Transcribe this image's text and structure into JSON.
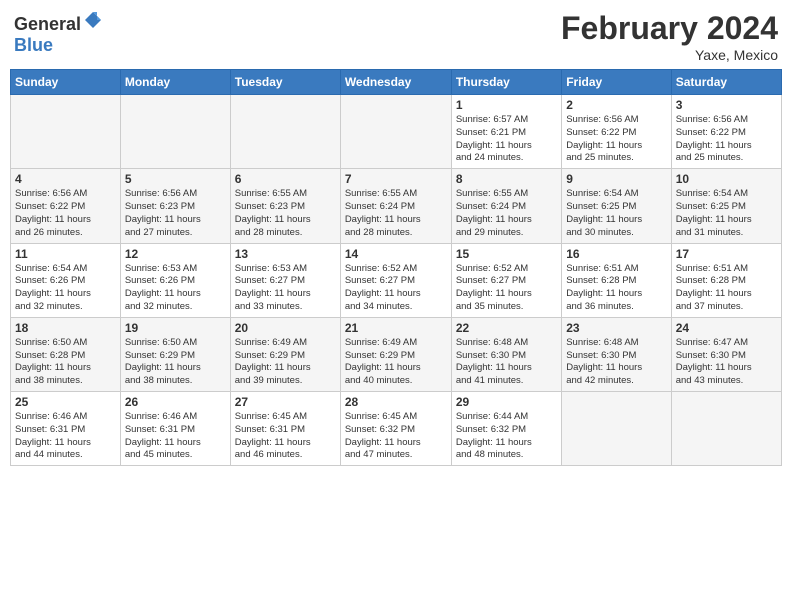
{
  "header": {
    "logo_general": "General",
    "logo_blue": "Blue",
    "month_year": "February 2024",
    "location": "Yaxe, Mexico"
  },
  "weekdays": [
    "Sunday",
    "Monday",
    "Tuesday",
    "Wednesday",
    "Thursday",
    "Friday",
    "Saturday"
  ],
  "weeks": [
    [
      {
        "day": "",
        "info": ""
      },
      {
        "day": "",
        "info": ""
      },
      {
        "day": "",
        "info": ""
      },
      {
        "day": "",
        "info": ""
      },
      {
        "day": "1",
        "info": "Sunrise: 6:57 AM\nSunset: 6:21 PM\nDaylight: 11 hours\nand 24 minutes."
      },
      {
        "day": "2",
        "info": "Sunrise: 6:56 AM\nSunset: 6:22 PM\nDaylight: 11 hours\nand 25 minutes."
      },
      {
        "day": "3",
        "info": "Sunrise: 6:56 AM\nSunset: 6:22 PM\nDaylight: 11 hours\nand 25 minutes."
      }
    ],
    [
      {
        "day": "4",
        "info": "Sunrise: 6:56 AM\nSunset: 6:22 PM\nDaylight: 11 hours\nand 26 minutes."
      },
      {
        "day": "5",
        "info": "Sunrise: 6:56 AM\nSunset: 6:23 PM\nDaylight: 11 hours\nand 27 minutes."
      },
      {
        "day": "6",
        "info": "Sunrise: 6:55 AM\nSunset: 6:23 PM\nDaylight: 11 hours\nand 28 minutes."
      },
      {
        "day": "7",
        "info": "Sunrise: 6:55 AM\nSunset: 6:24 PM\nDaylight: 11 hours\nand 28 minutes."
      },
      {
        "day": "8",
        "info": "Sunrise: 6:55 AM\nSunset: 6:24 PM\nDaylight: 11 hours\nand 29 minutes."
      },
      {
        "day": "9",
        "info": "Sunrise: 6:54 AM\nSunset: 6:25 PM\nDaylight: 11 hours\nand 30 minutes."
      },
      {
        "day": "10",
        "info": "Sunrise: 6:54 AM\nSunset: 6:25 PM\nDaylight: 11 hours\nand 31 minutes."
      }
    ],
    [
      {
        "day": "11",
        "info": "Sunrise: 6:54 AM\nSunset: 6:26 PM\nDaylight: 11 hours\nand 32 minutes."
      },
      {
        "day": "12",
        "info": "Sunrise: 6:53 AM\nSunset: 6:26 PM\nDaylight: 11 hours\nand 32 minutes."
      },
      {
        "day": "13",
        "info": "Sunrise: 6:53 AM\nSunset: 6:27 PM\nDaylight: 11 hours\nand 33 minutes."
      },
      {
        "day": "14",
        "info": "Sunrise: 6:52 AM\nSunset: 6:27 PM\nDaylight: 11 hours\nand 34 minutes."
      },
      {
        "day": "15",
        "info": "Sunrise: 6:52 AM\nSunset: 6:27 PM\nDaylight: 11 hours\nand 35 minutes."
      },
      {
        "day": "16",
        "info": "Sunrise: 6:51 AM\nSunset: 6:28 PM\nDaylight: 11 hours\nand 36 minutes."
      },
      {
        "day": "17",
        "info": "Sunrise: 6:51 AM\nSunset: 6:28 PM\nDaylight: 11 hours\nand 37 minutes."
      }
    ],
    [
      {
        "day": "18",
        "info": "Sunrise: 6:50 AM\nSunset: 6:28 PM\nDaylight: 11 hours\nand 38 minutes."
      },
      {
        "day": "19",
        "info": "Sunrise: 6:50 AM\nSunset: 6:29 PM\nDaylight: 11 hours\nand 38 minutes."
      },
      {
        "day": "20",
        "info": "Sunrise: 6:49 AM\nSunset: 6:29 PM\nDaylight: 11 hours\nand 39 minutes."
      },
      {
        "day": "21",
        "info": "Sunrise: 6:49 AM\nSunset: 6:29 PM\nDaylight: 11 hours\nand 40 minutes."
      },
      {
        "day": "22",
        "info": "Sunrise: 6:48 AM\nSunset: 6:30 PM\nDaylight: 11 hours\nand 41 minutes."
      },
      {
        "day": "23",
        "info": "Sunrise: 6:48 AM\nSunset: 6:30 PM\nDaylight: 11 hours\nand 42 minutes."
      },
      {
        "day": "24",
        "info": "Sunrise: 6:47 AM\nSunset: 6:30 PM\nDaylight: 11 hours\nand 43 minutes."
      }
    ],
    [
      {
        "day": "25",
        "info": "Sunrise: 6:46 AM\nSunset: 6:31 PM\nDaylight: 11 hours\nand 44 minutes."
      },
      {
        "day": "26",
        "info": "Sunrise: 6:46 AM\nSunset: 6:31 PM\nDaylight: 11 hours\nand 45 minutes."
      },
      {
        "day": "27",
        "info": "Sunrise: 6:45 AM\nSunset: 6:31 PM\nDaylight: 11 hours\nand 46 minutes."
      },
      {
        "day": "28",
        "info": "Sunrise: 6:45 AM\nSunset: 6:32 PM\nDaylight: 11 hours\nand 47 minutes."
      },
      {
        "day": "29",
        "info": "Sunrise: 6:44 AM\nSunset: 6:32 PM\nDaylight: 11 hours\nand 48 minutes."
      },
      {
        "day": "",
        "info": ""
      },
      {
        "day": "",
        "info": ""
      }
    ]
  ]
}
